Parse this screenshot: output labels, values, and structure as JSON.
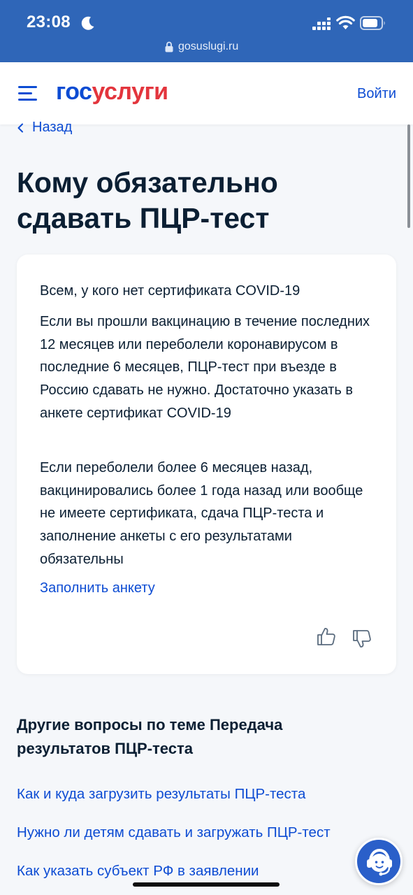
{
  "status_bar": {
    "time": "23:08"
  },
  "browser": {
    "url": "gosuslugi.ru"
  },
  "header": {
    "logo_part1": "гос",
    "logo_part2": "услуги",
    "login_label": "Войти"
  },
  "nav": {
    "back_label": "Назад"
  },
  "page": {
    "title": "Кому обязательно сдавать ПЦР-тест"
  },
  "card": {
    "heading": "Всем, у кого нет сертификата COVID-19",
    "paragraph1": "Если вы прошли вакцинацию в течение последних 12 месяцев или переболели коронавирусом в последние 6 месяцев, ПЦР-тест при въезде в Россию сдавать не нужно. Достаточно указать в анкете сертификат COVID-19",
    "paragraph2": "Если переболели более 6 месяцев назад, вакцинировались более 1 года назад или вообще не имеете сертификата, сдача ПЦР-теста и заполнение анкеты с его результатами обязательны",
    "action_link": "Заполнить анкету"
  },
  "related": {
    "title": "Другие вопросы по теме Передача результатов ПЦР-теста",
    "links": [
      "Как и куда загрузить результаты ПЦР-теста",
      "Нужно ли детям сдавать и загружать ПЦР-тест",
      "Как указать субъект РФ в заявлении"
    ]
  },
  "icons": {
    "menu": "hamburger-menu-icon",
    "back": "chevron-left-icon",
    "like": "thumb-up-icon",
    "dislike": "thumb-down-icon",
    "support": "support-operator-icon",
    "lock": "lock-icon"
  },
  "colors": {
    "brand_blue": "#0d4cd3",
    "brand_red": "#e3353d",
    "browser_bar": "#2f66b8",
    "page_background": "#f5f7fa",
    "text": "#0b1f33"
  }
}
